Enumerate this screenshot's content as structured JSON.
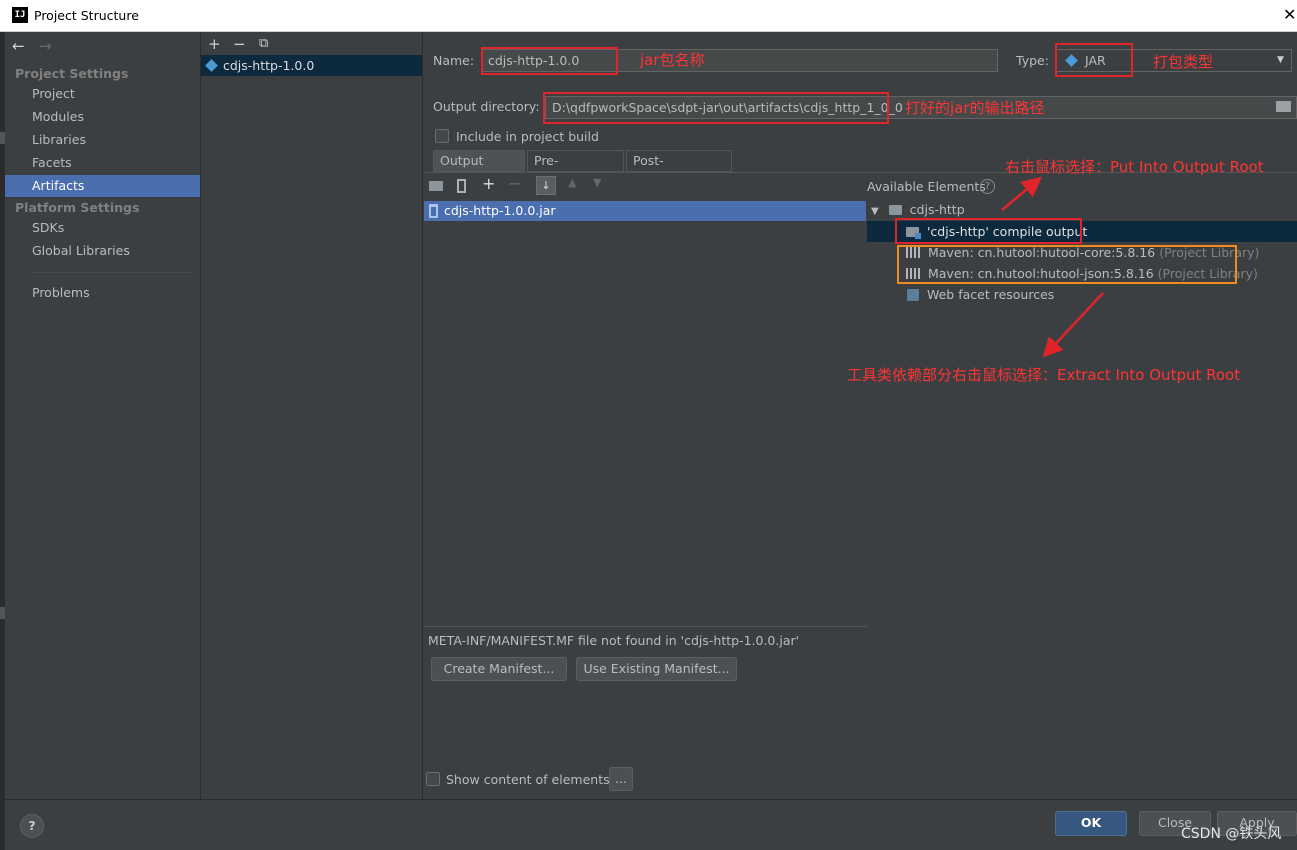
{
  "window": {
    "title": "Project Structure",
    "close_glyph": "✕"
  },
  "sidebar": {
    "back": "←",
    "forward": "→",
    "project_settings_heading": "Project Settings",
    "project_items": [
      "Project",
      "Modules",
      "Libraries",
      "Facets",
      "Artifacts"
    ],
    "selected_item": "Artifacts",
    "platform_settings_heading": "Platform Settings",
    "platform_items": [
      "SDKs",
      "Global Libraries"
    ],
    "problems": "Problems"
  },
  "artifact_list": {
    "toolbar": {
      "add": "+",
      "remove": "−",
      "copy": "⧉"
    },
    "items": [
      "cdjs-http-1.0.0"
    ]
  },
  "main": {
    "name_label": "Name:",
    "name_value": "cdjs-http-1.0.0",
    "type_label": "Type:",
    "type_value": "JAR",
    "output_dir_label": "Output directory:",
    "output_dir_value": "D:\\qdfpworkSpace\\sdpt-jar\\out\\artifacts\\cdjs_http_1_0_0",
    "include_in_build": "Include in project build",
    "tabs": [
      "Output Layout",
      "Pre-processing",
      "Post-processing"
    ],
    "layout_items": [
      "cdjs-http-1.0.0.jar"
    ],
    "available_elements_label": "Available Elements",
    "tree": {
      "root": "cdjs-http",
      "compile_output": "'cdjs-http' compile output",
      "libraries": [
        {
          "name": "Maven: cn.hutool:hutool-core:5.8.16",
          "scope": "(Project Library)"
        },
        {
          "name": "Maven: cn.hutool:hutool-json:5.8.16",
          "scope": "(Project Library)"
        }
      ],
      "web_facet": "Web facet resources"
    },
    "manifest_message": "META-INF/MANIFEST.MF file not found in 'cdjs-http-1.0.0.jar'",
    "create_manifest": "Create Manifest...",
    "use_existing_manifest": "Use Existing Manifest...",
    "show_content": "Show content of elements",
    "ellipsis_button": "..."
  },
  "annotations": {
    "jar_name": "jar包名称",
    "package_type": "打包类型",
    "output_path": "打好的jar的输出路径",
    "put_into_root": "右击鼠标选择：Put Into Output Root",
    "extract_into_root": "工具类依赖部分右击鼠标选择：Extract Into Output Root"
  },
  "footer": {
    "help": "?",
    "ok": "OK",
    "close": "Close",
    "apply": "Apply"
  },
  "watermark": "CSDN @铁头风",
  "colors": {
    "selection": "#4b6eaf",
    "annotation_red": "#e0242a",
    "annotation_orange": "#f08c1e",
    "ok_button": "#365880"
  }
}
